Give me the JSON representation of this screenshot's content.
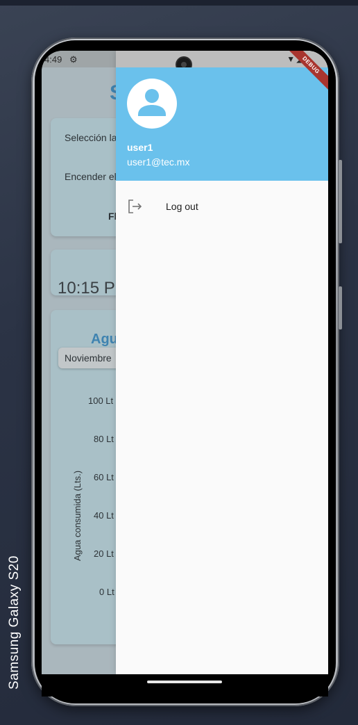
{
  "device": {
    "label": "Samsung Galaxy  S20"
  },
  "status": {
    "time": "4:49"
  },
  "background_app": {
    "title": "S",
    "card1": {
      "line1": "Selección la",
      "line2": "Encender el",
      "line3": "Fl"
    },
    "clock": "10:15 P",
    "section": "Agu",
    "dropdown_value": "Noviembre",
    "y_axis_label": "Agua consumida (Lts.)",
    "y_ticks": [
      "100 Lt",
      "80 Lt",
      "60 Lt",
      "40 Lt",
      "20 Lt",
      "0 Lt"
    ]
  },
  "drawer": {
    "user_name": "user1",
    "user_email": "user1@tec.mx",
    "items": [
      {
        "label": "Log out",
        "icon": "logout-icon"
      }
    ],
    "debug_banner": "DEBUG"
  },
  "colors": {
    "header": "#6ac1ec",
    "accent": "#3f83b0",
    "drawer_bg": "#fafafa"
  }
}
